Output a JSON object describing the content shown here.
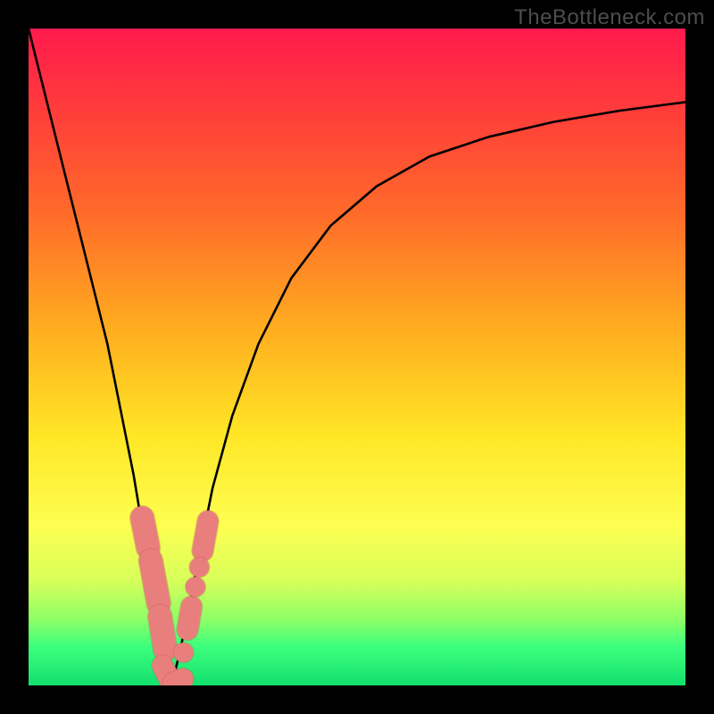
{
  "watermark": "TheBottleneck.com",
  "chart_data": {
    "type": "line",
    "title": "",
    "xlabel": "",
    "ylabel": "",
    "ylim": [
      0,
      100
    ],
    "xlim": [
      0,
      100
    ],
    "notes": "Two black curves forming a V-shaped dip on a red→yellow→green vertical gradient; pink bead markers clustered near the bottom of the V.",
    "series": [
      {
        "name": "left-curve",
        "x": [
          0,
          3,
          6,
          9,
          12,
          14,
          16,
          17.5,
          18.5,
          19.3,
          20,
          20.6,
          21.2,
          21.8
        ],
        "values": [
          100,
          88,
          76,
          64,
          52,
          42,
          32,
          23,
          16,
          10,
          6,
          3,
          1.2,
          0
        ]
      },
      {
        "name": "right-curve",
        "x": [
          21.8,
          23,
          24.5,
          26,
          28,
          31,
          35,
          40,
          46,
          53,
          61,
          70,
          80,
          90,
          100
        ],
        "values": [
          0,
          5,
          12,
          20,
          30,
          41,
          52,
          62,
          70,
          76,
          80.5,
          83.5,
          85.8,
          87.5,
          88.8
        ]
      }
    ],
    "markers": {
      "color": "#e97f7d",
      "stroke": "#b55553",
      "points_capsule": [
        {
          "x1": 17.3,
          "y1": 25.5,
          "x2": 18.2,
          "y2": 21.0,
          "r": 1.8
        },
        {
          "x1": 18.6,
          "y1": 19.0,
          "x2": 19.8,
          "y2": 12.5,
          "r": 1.8
        },
        {
          "x1": 20.0,
          "y1": 10.5,
          "x2": 20.8,
          "y2": 5.5,
          "r": 1.8
        },
        {
          "x1": 20.4,
          "y1": 3.0,
          "x2": 21.8,
          "y2": 0.3,
          "r": 1.6
        },
        {
          "x1": 22.0,
          "y1": 0.3,
          "x2": 23.5,
          "y2": 1.0,
          "r": 1.6
        },
        {
          "x1": 24.2,
          "y1": 8.5,
          "x2": 24.8,
          "y2": 12.0,
          "r": 1.6
        },
        {
          "x1": 26.5,
          "y1": 20.5,
          "x2": 27.3,
          "y2": 25.0,
          "r": 1.6
        }
      ],
      "points_dot": [
        {
          "x": 23.6,
          "y": 5.0,
          "r": 1.5
        },
        {
          "x": 25.4,
          "y": 15.0,
          "r": 1.5
        },
        {
          "x": 26.0,
          "y": 18.0,
          "r": 1.5
        }
      ]
    }
  }
}
